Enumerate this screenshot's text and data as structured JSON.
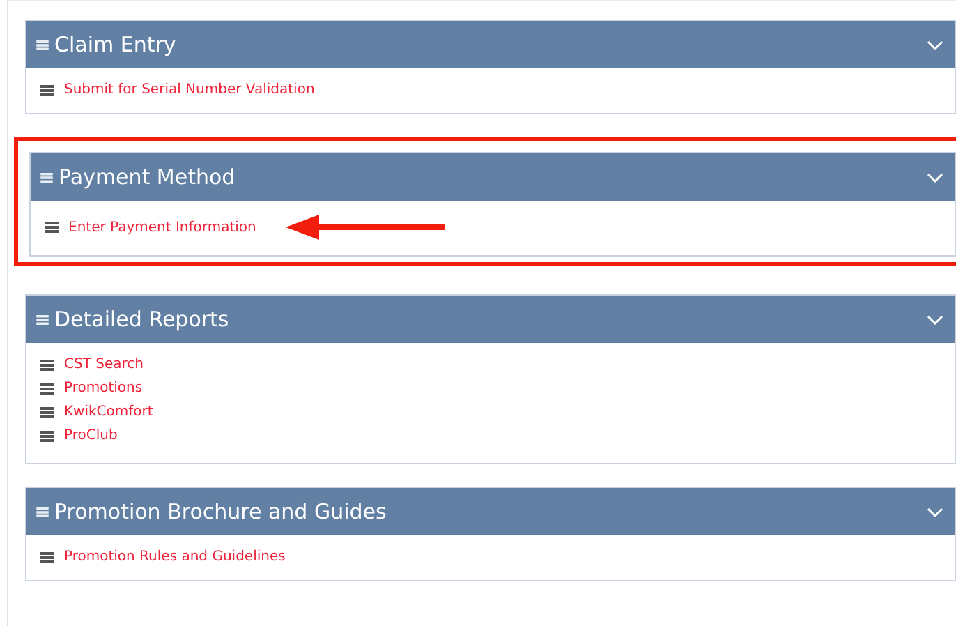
{
  "panels": [
    {
      "title": "Claim Entry",
      "highlighted": false,
      "links": [
        "Submit for Serial Number Validation"
      ]
    },
    {
      "title": "Payment Method",
      "highlighted": true,
      "links": [
        "Enter Payment Information"
      ]
    },
    {
      "title": "Detailed Reports",
      "highlighted": false,
      "links": [
        "CST Search",
        "Promotions",
        "KwikComfort",
        "ProClub"
      ]
    },
    {
      "title": "Promotion Brochure and Guides",
      "highlighted": false,
      "links": [
        "Promotion Rules and Guidelines"
      ]
    }
  ]
}
